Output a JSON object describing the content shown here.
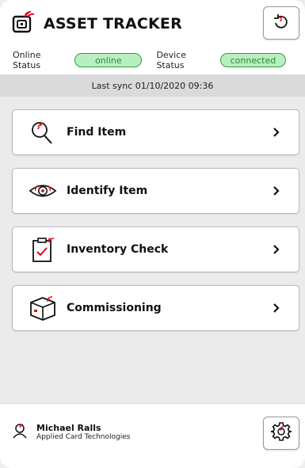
{
  "app": {
    "title": "ASSET TRACKER",
    "logo_icon": "nfc-card-icon",
    "refresh_icon": "refresh-icon"
  },
  "status": {
    "online_label": "Online Status",
    "online_value": "online",
    "device_label": "Device Status",
    "device_value": "connected"
  },
  "sync": {
    "text": "Last sync 01/10/2020  09:36"
  },
  "menu": [
    {
      "label": "Find Item",
      "icon": "search-signal-icon"
    },
    {
      "label": "Identify Item",
      "icon": "eye-signal-icon"
    },
    {
      "label": "Inventory Check",
      "icon": "clipboard-check-icon"
    },
    {
      "label": "Commissioning",
      "icon": "box-signal-icon"
    }
  ],
  "user": {
    "name": "Michael Ralls",
    "company": "Applied Card Technologies",
    "icon": "user-signal-icon",
    "settings_icon": "gear-signal-icon"
  },
  "colors": {
    "accent_red": "#e30613",
    "status_green": "#2f9e3a",
    "status_green_fill": "#b8efc0"
  }
}
